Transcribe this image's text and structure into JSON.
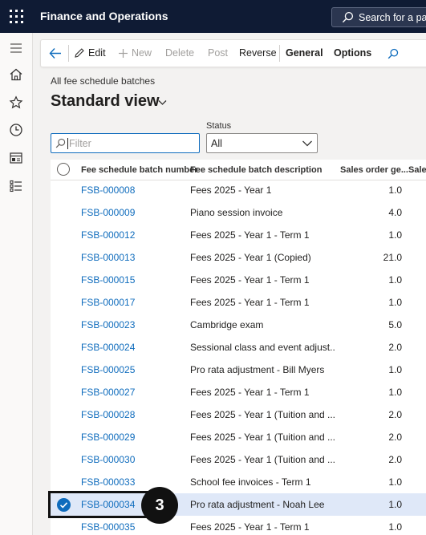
{
  "app": {
    "title": "Finance and Operations",
    "search_placeholder": "Search for a page"
  },
  "rail": {
    "items": [
      "hamburger-icon",
      "home-icon",
      "star-icon",
      "clock-icon",
      "workspace-icon",
      "list-icon"
    ]
  },
  "toolbar": {
    "edit": "Edit",
    "new": "New",
    "delete": "Delete",
    "post": "Post",
    "reverse": "Reverse",
    "general": "General",
    "options": "Options"
  },
  "page": {
    "breadcrumb": "All fee schedule batches",
    "title": "Standard view"
  },
  "filter": {
    "placeholder": "Filter"
  },
  "status": {
    "label": "Status",
    "value": "All"
  },
  "grid": {
    "columns": [
      "Fee schedule batch number",
      "Fee schedule batch description",
      "Sales order ge...",
      "Sales"
    ],
    "rows": [
      {
        "id": "FSB-000008",
        "desc": "Fees 2025 -  Year 1",
        "num": "1.0"
      },
      {
        "id": "FSB-000009",
        "desc": "Piano session invoice",
        "num": "4.0"
      },
      {
        "id": "FSB-000012",
        "desc": "Fees 2025 -  Year 1 - Term 1",
        "num": "1.0"
      },
      {
        "id": "FSB-000013",
        "desc": "Fees 2025 -  Year 1 (Copied)",
        "num": "21.0"
      },
      {
        "id": "FSB-000015",
        "desc": "Fees 2025 -  Year 1 - Term 1",
        "num": "1.0"
      },
      {
        "id": "FSB-000017",
        "desc": "Fees 2025 -  Year 1 - Term 1",
        "num": "1.0"
      },
      {
        "id": "FSB-000023",
        "desc": "Cambridge exam",
        "num": "5.0"
      },
      {
        "id": "FSB-000024",
        "desc": "Sessional class and event adjust...",
        "num": "2.0"
      },
      {
        "id": "FSB-000025",
        "desc": "Pro rata adjustment - Bill Myers",
        "num": "1.0"
      },
      {
        "id": "FSB-000027",
        "desc": "Fees 2025 -  Year 1 - Term 1",
        "num": "1.0"
      },
      {
        "id": "FSB-000028",
        "desc": "Fees 2025 -  Year 1 (Tuition and ...",
        "num": "2.0"
      },
      {
        "id": "FSB-000029",
        "desc": "Fees 2025 -  Year 1 (Tuition and ...",
        "num": "2.0"
      },
      {
        "id": "FSB-000030",
        "desc": "Fees 2025 -  Year 1 (Tuition and ...",
        "num": "2.0"
      },
      {
        "id": "FSB-000033",
        "desc": "School fee invoices - Term 1",
        "num": "1.0"
      },
      {
        "id": "FSB-000034",
        "desc": "Pro rata adjustment - Noah Lee",
        "num": "1.0"
      },
      {
        "id": "FSB-000035",
        "desc": "Fees 2025 -  Year 1 - Term 1",
        "num": "1.0"
      }
    ]
  },
  "annotation": {
    "step": "3"
  },
  "colors": {
    "topbar": "#0f1b34",
    "link": "#0f6cbd",
    "selected_row": "#dfe8f8"
  }
}
